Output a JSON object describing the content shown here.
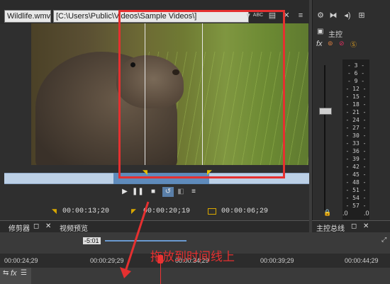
{
  "preview": {
    "media_select": "Wildlife.wmv",
    "path": "[C:\\Users\\Public\\Videos\\Sample Videos\\]",
    "prop_icon": "ABC"
  },
  "transport": {
    "in_time": "00:00:13;20",
    "out_time": "00:00:20;19",
    "length": "00:00:06;29"
  },
  "tabs": {
    "trimmer": "修剪器",
    "video_preview": "视频预览",
    "master_bus": "主控总线"
  },
  "master": {
    "label": "主控",
    "fx": "fx",
    "scale": [
      "3",
      "6",
      "9",
      "12",
      "15",
      "18",
      "21",
      "24",
      "27",
      "30",
      "33",
      "36",
      "39",
      "42",
      "45",
      "48",
      "51",
      "54",
      "57"
    ],
    "bottom_left": ".0",
    "bottom_right": ".0"
  },
  "timeline": {
    "offset": "-5:01",
    "ticks": [
      "00:00:24;29",
      "00:00:29;29",
      "00:00:34;29",
      "00:00:39;29",
      "00:00:44;29"
    ],
    "track_fx": "fx"
  },
  "annotation": "拖放到时间线上"
}
